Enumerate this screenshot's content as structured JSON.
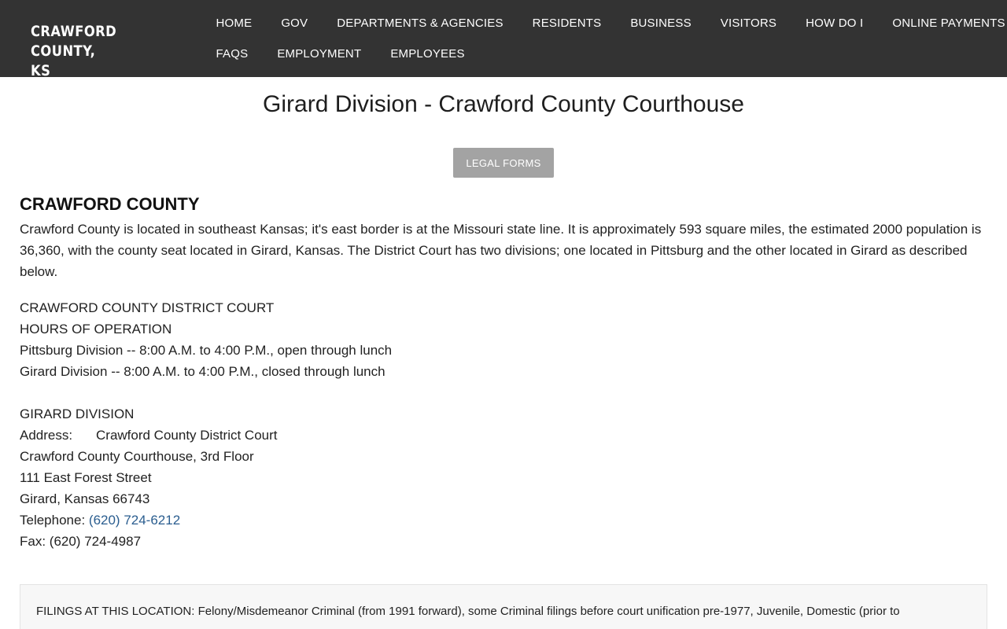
{
  "header": {
    "logo_line1": "CRAWFORD COUNTY,",
    "logo_line2": "KS",
    "nav_row1": [
      "HOME",
      "GOV",
      "DEPARTMENTS & AGENCIES",
      "RESIDENTS",
      "BUSINESS",
      "VISITORS",
      "HOW DO I",
      "ONLINE PAYMENTS"
    ],
    "nav_row2": [
      "FAQS",
      "EMPLOYMENT",
      "EMPLOYEES"
    ]
  },
  "main": {
    "title": "Girard Division - Crawford County Courthouse",
    "legal_forms_button": "LEGAL FORMS",
    "section_heading": "CRAWFORD COUNTY",
    "intro": "Crawford County is located in southeast Kansas; it's east border is at the Missouri state line. It is approximately 593 square miles, the estimated 2000 population is 36,360, with the county seat located in Girard, Kansas. The District Court has two divisions; one located in Pittsburg and the other located in Girard as described below.",
    "court_name": "CRAWFORD COUNTY DISTRICT COURT",
    "hours_heading": "HOURS OF OPERATION",
    "pittsburg_hours": "Pittsburg Division -- 8:00 A.M. to 4:00 P.M., open through lunch",
    "girard_hours": "Girard Division -- 8:00 A.M. to 4:00 P.M., closed through lunch",
    "division_heading": "GIRARD DIVISION",
    "address_label": "Address:",
    "address_line1": "Crawford County District Court",
    "address_line2": "Crawford County Courthouse, 3rd Floor",
    "address_line3": "111 East Forest Street",
    "address_line4": "Girard, Kansas 66743",
    "telephone_label": "Telephone: ",
    "telephone": "(620) 724-6212",
    "fax": "Fax: (620) 724-4987",
    "filings": "FILINGS AT THIS LOCATION: Felony/Misdemeanor Criminal (from 1991 forward), some Criminal filings before court unification pre-1977, Juvenile, Domestic (prior to"
  },
  "colors": {
    "header_bg": "#333333",
    "button_bg": "#a3a3a3",
    "link": "#2a5d8f",
    "box_bg": "#f7f7f7"
  }
}
